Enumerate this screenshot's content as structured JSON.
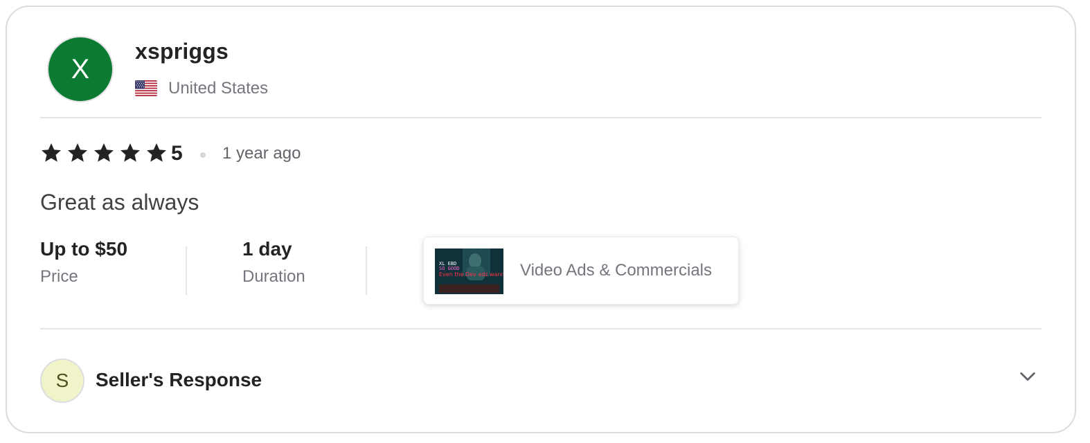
{
  "reviewer": {
    "avatar_initial": "X",
    "avatar_color": "#0b7a32",
    "username": "xspriggs",
    "country": "United States",
    "flag_icon": "us-flag-icon"
  },
  "review": {
    "rating_stars": 5,
    "rating_value": "5",
    "time_ago": "1 year ago",
    "text": "Great as always"
  },
  "meta": {
    "price_value": "Up to $50",
    "price_label": "Price",
    "duration_value": "1 day",
    "duration_label": "Duration"
  },
  "gig": {
    "title": "Video Ads & Commercials",
    "thumb_caption": "Even the Dev ads wanna Dip"
  },
  "seller_response": {
    "avatar_initial": "S",
    "label": "Seller's Response",
    "toggle_icon": "chevron-down-icon"
  },
  "colors": {
    "star": "#222325",
    "avatar_bg": "#0b7a32",
    "seller_avatar_bg": "#f1f3c9"
  }
}
